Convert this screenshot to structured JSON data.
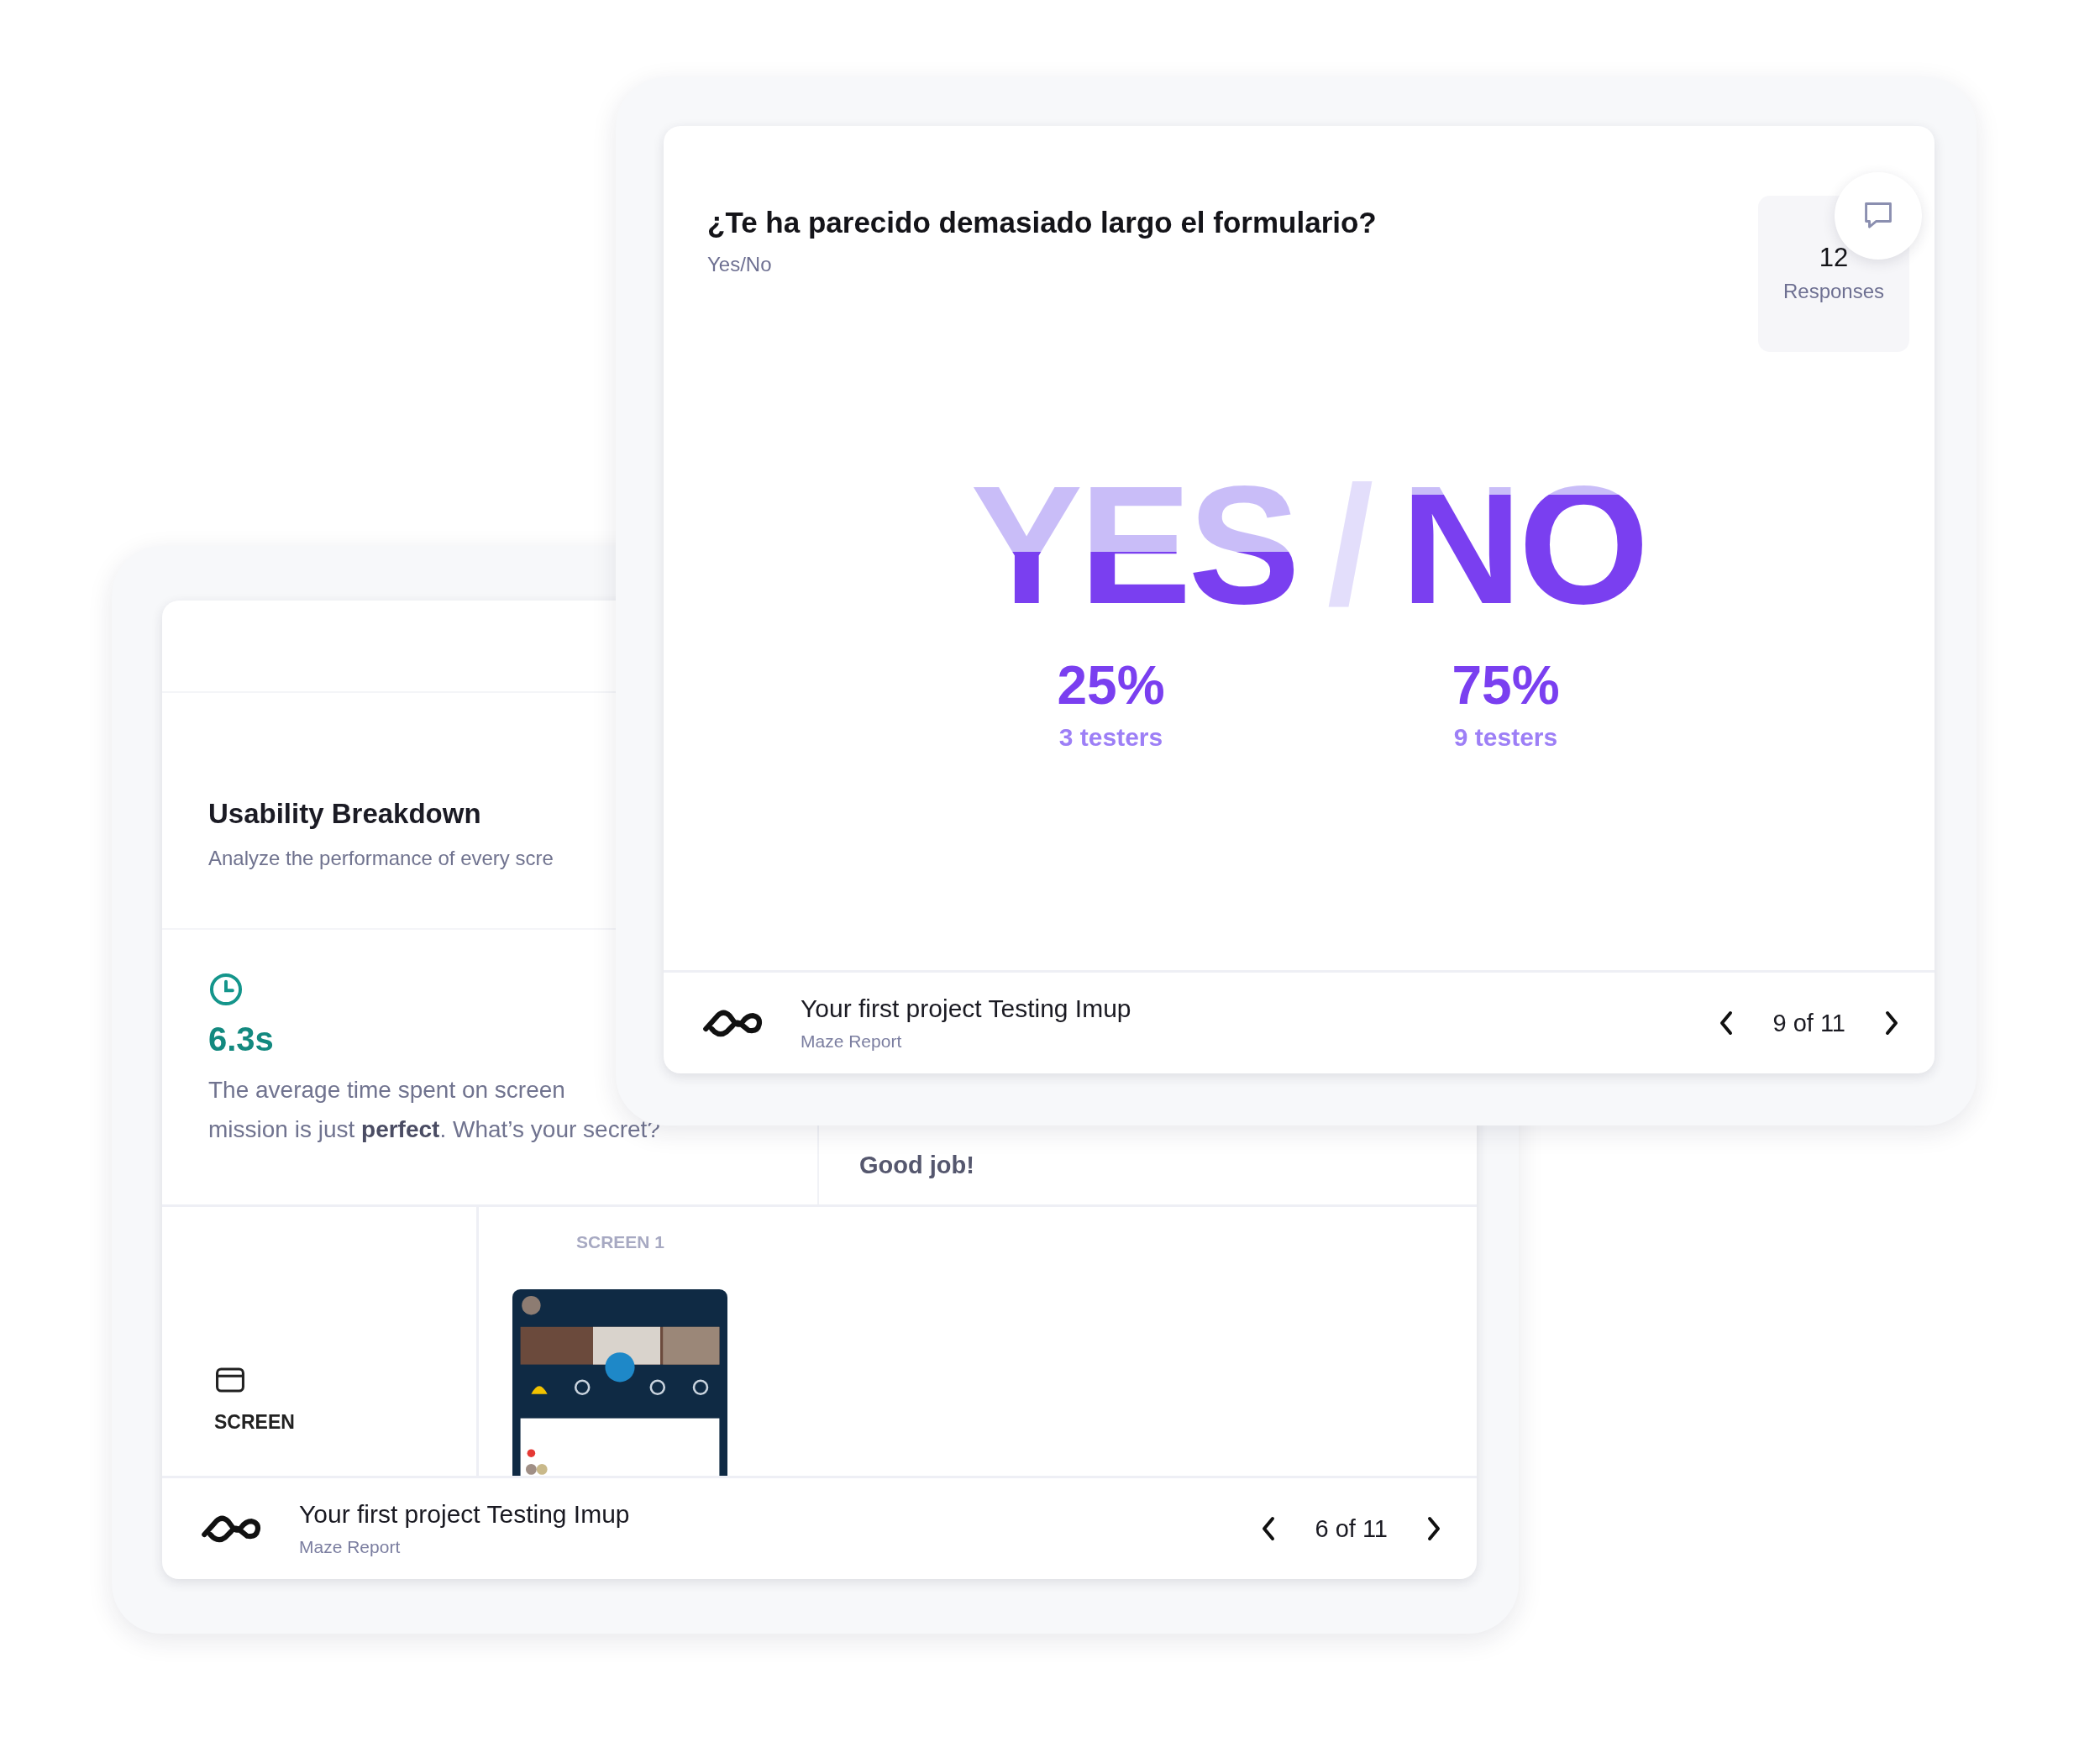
{
  "usability_card": {
    "heading": "Usability Breakdown",
    "subtitle": "Analyze the performance of every scre",
    "metric": {
      "value": "6.3s",
      "description_lines": [
        "The average time spent on screen",
        "mission is just **perfect**. What’s your secret?"
      ]
    },
    "side_note": "Good job!",
    "screen_row": {
      "label": "SCREEN",
      "column_header": "SCREEN 1"
    },
    "footer": {
      "project": "Your first project Testing Imup",
      "subtitle": "Maze Report",
      "pager": "6 of 11"
    }
  },
  "question_card": {
    "question": "¿Te ha parecido demasiado largo el formulario?",
    "type": "Yes/No",
    "responses": {
      "count": "12",
      "label": "Responses"
    },
    "separator": "/",
    "answers": [
      {
        "label": "YES",
        "leading": false,
        "percent": "25%",
        "testers": "3 testers"
      },
      {
        "label": "NO",
        "leading": true,
        "percent": "75%",
        "testers": "9 testers"
      }
    ],
    "footer": {
      "project": "Your first project Testing Imup",
      "subtitle": "Maze Report",
      "pager": "9 of 11"
    }
  }
}
